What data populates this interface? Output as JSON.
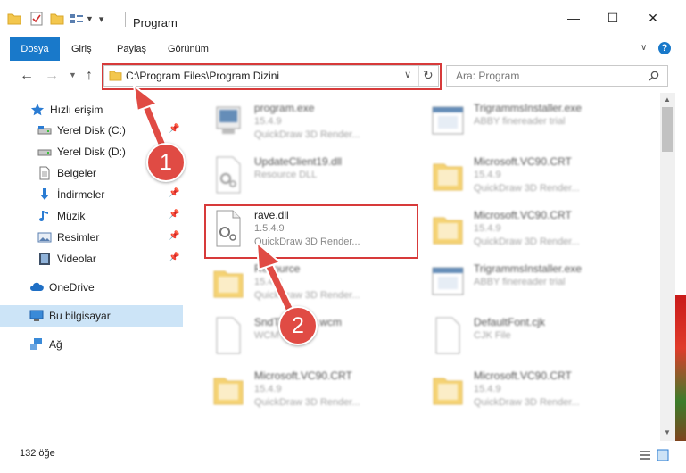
{
  "window": {
    "title": "Program"
  },
  "ribbon": {
    "tabs": [
      {
        "label": "Dosya",
        "active": true
      },
      {
        "label": "Giriş"
      },
      {
        "label": "Paylaş"
      },
      {
        "label": "Görünüm"
      }
    ]
  },
  "address": {
    "path": "C:\\Program Files\\Program Dizini"
  },
  "search": {
    "placeholder": "Ara: Program"
  },
  "sidebar": {
    "items": [
      {
        "label": "Hızlı erişim",
        "icon": "star-icon"
      },
      {
        "label": "Yerel Disk (C:)",
        "icon": "drive-icon"
      },
      {
        "label": "Yerel Disk (D:)",
        "icon": "drive-icon"
      },
      {
        "label": "Belgeler",
        "icon": "document-icon"
      },
      {
        "label": "İndirmeler",
        "icon": "download-icon"
      },
      {
        "label": "Müzik",
        "icon": "music-icon"
      },
      {
        "label": "Resimler",
        "icon": "picture-icon"
      },
      {
        "label": "Videolar",
        "icon": "video-icon"
      },
      {
        "label": "OneDrive",
        "icon": "cloud-icon"
      },
      {
        "label": "Bu bilgisayar",
        "icon": "computer-icon"
      },
      {
        "label": "Ağ",
        "icon": "network-icon"
      }
    ]
  },
  "files": {
    "left": [
      {
        "name": "program.exe",
        "line2": "15.4.9",
        "line3": "QuickDraw 3D Render..."
      },
      {
        "name": "UpdateClient19.dll",
        "line2": "Resource DLL",
        "line3": ""
      },
      {
        "name": "rave.dll",
        "line2": "1.5.4.9",
        "line3": "QuickDraw 3D Render..."
      },
      {
        "name": "Resource",
        "line2": "15.4.9",
        "line3": "QuickDraw 3D Render..."
      },
      {
        "name": "SndTDomain.wcm",
        "line2": "WCM",
        "line3": ""
      },
      {
        "name": "Microsoft.VC90.CRT",
        "line2": "15.4.9",
        "line3": "QuickDraw 3D Render..."
      }
    ],
    "right": [
      {
        "name": "TrigrammsInstaller.exe",
        "line2": "ABBY finereader trial",
        "line3": ""
      },
      {
        "name": "Microsoft.VC90.CRT",
        "line2": "15.4.9",
        "line3": "QuickDraw 3D Render..."
      },
      {
        "name": "Microsoft.VC90.CRT",
        "line2": "15.4.9",
        "line3": "QuickDraw 3D Render..."
      },
      {
        "name": "TrigrammsInstaller.exe",
        "line2": "ABBY finereader trial",
        "line3": ""
      },
      {
        "name": "DefaultFont.cjk",
        "line2": "CJK File",
        "line3": ""
      },
      {
        "name": "Microsoft.VC90.CRT",
        "line2": "15.4.9",
        "line3": "QuickDraw 3D Render..."
      }
    ]
  },
  "status": {
    "count": "132 öğe"
  },
  "annotations": {
    "step1": "1",
    "step2": "2"
  },
  "colors": {
    "accent": "#1979ca",
    "highlight": "#d73a3a",
    "badge": "#e04b44"
  }
}
